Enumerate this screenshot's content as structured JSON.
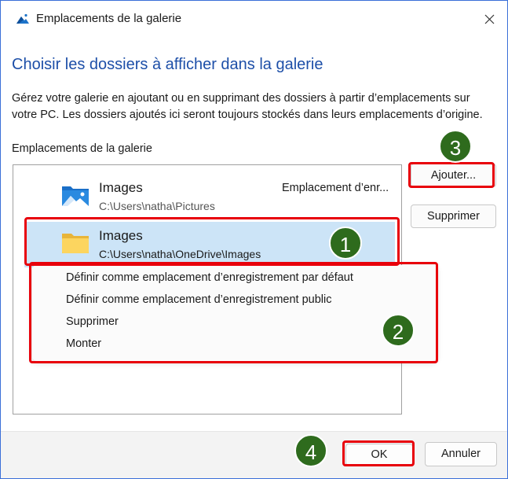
{
  "window": {
    "title": "Emplacements de la galerie",
    "icon": "gallery-icon"
  },
  "main": {
    "heading": "Choisir les dossiers à afficher dans la galerie",
    "description": "Gérez votre galerie en ajoutant ou en supprimant des dossiers à partir d’emplacements sur votre PC. Les dossiers ajoutés ici seront toujours stockés dans leurs emplacements d’origine.",
    "list_label": "Emplacements de la galerie"
  },
  "folders": [
    {
      "name": "Images",
      "path": "C:\\Users\\natha\\Pictures",
      "status": "Emplacement d’enr...",
      "icon": "pictures-folder-icon",
      "selected": false
    },
    {
      "name": "Images",
      "path": "C:\\Users\\natha\\OneDrive\\Images",
      "status": "",
      "icon": "yellow-folder-icon",
      "selected": true
    }
  ],
  "side_buttons": {
    "add": "Ajouter...",
    "remove": "Supprimer"
  },
  "context_menu": {
    "items": [
      "Définir comme emplacement d’enregistrement par défaut",
      "Définir comme emplacement d’enregistrement public",
      "Supprimer",
      "Monter"
    ]
  },
  "footer": {
    "ok": "OK",
    "cancel": "Annuler"
  },
  "annotations": {
    "badges": [
      "1",
      "2",
      "3",
      "4"
    ],
    "highlight_color": "#e8000b",
    "badge_color": "#2e6b1d"
  },
  "colors": {
    "accent": "#1d4fa8",
    "selection": "#cce4f7"
  }
}
